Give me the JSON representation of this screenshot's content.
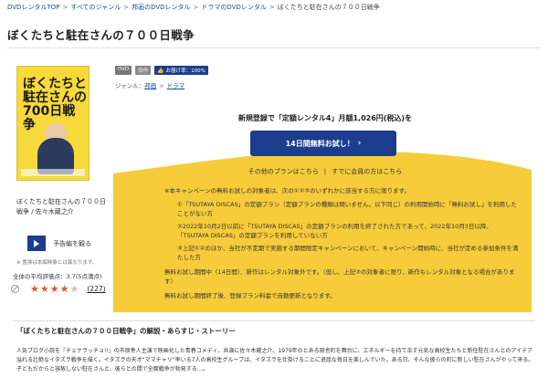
{
  "breadcrumb": {
    "items": [
      "DVDレンタルTOP",
      "すべてのジャンル",
      "邦画のDVDレンタル",
      "ドラマのDVDレンタル"
    ],
    "current": "ぼくたちと駐在さんの７００日戦争"
  },
  "page_title": "ぼくたちと駐在さんの７００日戦争",
  "cover": {
    "title_text": "ぼくたちと駐在さんの700日戦争"
  },
  "product": {
    "caption": "ぼくたちと駐在さんの７００日戦争 / 佐々木蔵之介",
    "trailer_label": "予告編を観る",
    "note": "※ 置換は本編映像とは異なります。",
    "rating_line": "全体の平均評価点：3.7(5点満点)",
    "rating_value": 3.7,
    "review_count": "(227)"
  },
  "tags": {
    "format": "DVD",
    "type": "旧作",
    "recommend": "お届け率：100%"
  },
  "genre": {
    "label": "ジャンル：",
    "items": [
      "邦画",
      "ドラマ"
    ]
  },
  "promo": {
    "heading": "新規登録で「定額レンタル4」月額1,026円(税込)を",
    "trial_button": "14日間無料お試し！",
    "other_plans": "その他のプランはこちら",
    "member_login": "すでに会員の方はこちら",
    "highlight_color": "#f7cc3a",
    "button_color": "#1c3d8e"
  },
  "conditions": {
    "lead": "※本キャンペーンの無料お試しの対象者は、次の①②③のいずれかに該当する方に限ります。",
    "items": [
      "①「TSUTAYA DISCAS」の定額プラン（定額プランの種類は問いません。以下同じ）の利用開始時に「無料お試し」を利用したことがない方",
      "②2022年10月2日以前に「TSUTAYA DISCAS」の定額プランの利用を終了された方であって、2022年10月3日以降、「TSUTAYA DISCAS」の定額プランを利用していない方",
      "③上記①②のほか、当社が不定期で実施する期間限定キャンペーンにおいて、キャンペーン開始時に、当社が定める参加条件を満たした方"
    ],
    "para1": "無料お試し期間中（14日間）、新作はレンタル対象外です。（但し、上記③の対象者に限り、新作もレンタル対象となる場合があります）",
    "para2": "無料お試し期間終了後、登録プラン料金で自動更新となります。"
  },
  "description": {
    "title": "「ぼくたちと駐在さんの７００日戦争」の解説・あらすじ・ストーリー",
    "text": "人気ブログ小説を『チェケラッチョ!!』の市原隼人主演で映画化した青春コメディ。共演に佐々木蔵之介。1979年のとある田舎町を舞台に、エネルギーを持て余す元気な高校生たちと新任駐在さんとのアイデア溢れる壮絶なイタズラ戦争を描く。イタズラの天才“ママチャリ”率いる7人の高校生グループは、イタズラを仕掛けることに退屈な毎日を楽しんでいた。ある日、そんな彼らの町に新しい駐在さんがやって来る。子どもだからと容赦しない駐在さんと、彼らとの間で全面戦争が勃発する…。"
  }
}
